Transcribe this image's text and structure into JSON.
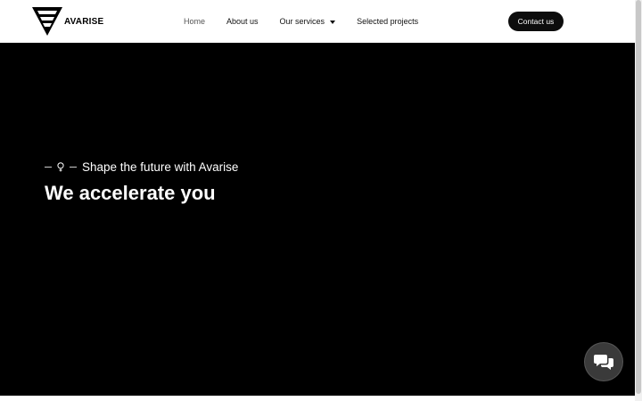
{
  "brand": {
    "name": "AVARISE"
  },
  "nav": {
    "items": [
      {
        "label": "Home",
        "active": true
      },
      {
        "label": "About us"
      },
      {
        "label": "Our services",
        "has_dropdown": true
      },
      {
        "label": "Selected projects"
      }
    ],
    "cta_label": "Contact us"
  },
  "hero": {
    "tagline": "Shape the future with Avarise",
    "headline": "We accelerate you"
  },
  "icons": {
    "logo": "avarise-logo-icon",
    "tagline": "lightbulb-icon",
    "chat": "chat-bubbles-icon",
    "dropdown": "caret-down-icon"
  },
  "colors": {
    "hero_background": "#000000",
    "header_background": "#ffffff",
    "cta_background": "#0d0d0d",
    "chat_button": "#3a3a3a",
    "text_light": "#ffffff",
    "nav_active": "#555555"
  }
}
